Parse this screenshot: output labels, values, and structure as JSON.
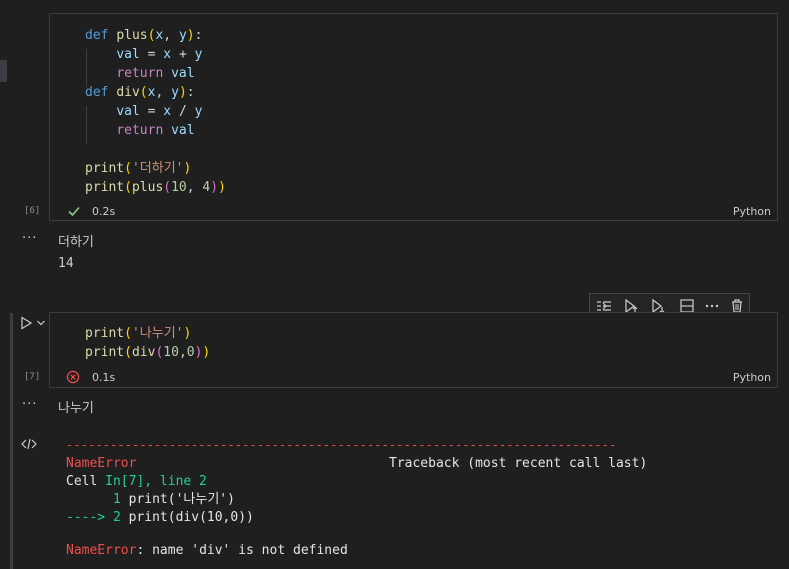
{
  "cell6": {
    "code_lines": [
      "def plus(x, y):",
      "    val = x + y",
      "    return val",
      "def div(x, y):",
      "    val = x / y",
      "    return val",
      "",
      "print('더하기')",
      "print(plus(10, 4))"
    ],
    "execution_count": "[6]",
    "duration": "0.2s",
    "language": "Python",
    "status": "success"
  },
  "output6": {
    "dots": "···",
    "lines": [
      "더하기",
      "14"
    ]
  },
  "cell7": {
    "code_lines": [
      "print('나누기')",
      "print(div(10,0))"
    ],
    "execution_count": "[7]",
    "duration": "0.1s",
    "language": "Python",
    "status": "error"
  },
  "output7": {
    "dots": "···",
    "stdout": "나누기",
    "error_rule": "---------------------------------------------------------------------------",
    "error_name": "NameError",
    "traceback_label": "Traceback (most recent call last)",
    "cell_ref_prefix": "Cell ",
    "cell_ref_link": "In[7], line 2",
    "trace_line1_no": "      1 ",
    "trace_line1_code": "print('나누기')",
    "trace_line2_arrow": "----> 2 ",
    "trace_line2_code": "print(div(10,0))",
    "final_error_name": "NameError",
    "final_error_msg": ": name 'div' is not defined"
  },
  "toolbar": {
    "buttons": [
      "execute-above-icon",
      "execute-cell-and-below-icon",
      "execute-cell-and-above-icon",
      "split-cell-icon",
      "more-actions-icon",
      "delete-cell-icon"
    ]
  },
  "colors": {
    "success": "#89d185",
    "error": "#f14c4c",
    "keyword": "#569cd6",
    "function": "#dcdcaa",
    "string": "#ce9178"
  }
}
